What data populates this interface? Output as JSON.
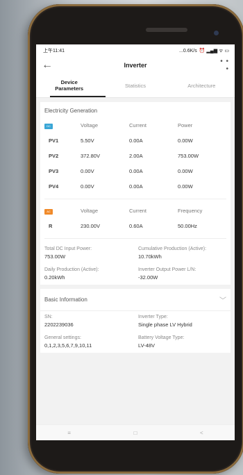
{
  "status": {
    "time": "上午11:41",
    "net": "...0.6K/s",
    "icons": "⏰ ▂▄▆ ᯤ ▭"
  },
  "header": {
    "back": "←",
    "title": "Inverter",
    "more": "• • •"
  },
  "tabs": [
    {
      "label_line1": "Device",
      "label_line2": "Parameters"
    },
    {
      "label": "Statistics"
    },
    {
      "label": "Architecture"
    }
  ],
  "generation": {
    "title": "Electricity Generation",
    "dc_badge": "DC",
    "dc_headers": [
      "Voltage",
      "Current",
      "Power"
    ],
    "dc_rows": [
      {
        "name": "PV1",
        "voltage": "5.50V",
        "current": "0.00A",
        "power": "0.00W"
      },
      {
        "name": "PV2",
        "voltage": "372.80V",
        "current": "2.00A",
        "power": "753.00W"
      },
      {
        "name": "PV3",
        "voltage": "0.00V",
        "current": "0.00A",
        "power": "0.00W"
      },
      {
        "name": "PV4",
        "voltage": "0.00V",
        "current": "0.00A",
        "power": "0.00W"
      }
    ],
    "ac_badge": "AC",
    "ac_headers": [
      "Voltage",
      "Current",
      "Frequency"
    ],
    "ac_row": {
      "name": "R",
      "voltage": "230.00V",
      "current": "0.60A",
      "frequency": "50.00Hz"
    },
    "summary": [
      {
        "label": "Total DC Input Power:",
        "value": "753.00W"
      },
      {
        "label": "Cumulative Production (Active):",
        "value": "10.70kWh"
      },
      {
        "label": "Daily Production (Active):",
        "value": "0.20kWh"
      },
      {
        "label": "Inverter Output Power L/N:",
        "value": "-32.00W"
      }
    ]
  },
  "basic": {
    "title": "Basic Information",
    "chevron": "﹀",
    "items": [
      {
        "label": "SN:",
        "value": "2202239036"
      },
      {
        "label": "Inverter Type:",
        "value": "Single phase LV Hybrid"
      },
      {
        "label": "General settings:",
        "value": "0,1,2,3,5,6,7,9,10,11"
      },
      {
        "label": "Battery Voltage Type:",
        "value": "LV-48V"
      }
    ]
  },
  "navbar": {
    "menu": "≡",
    "home": "□",
    "back": "<"
  }
}
